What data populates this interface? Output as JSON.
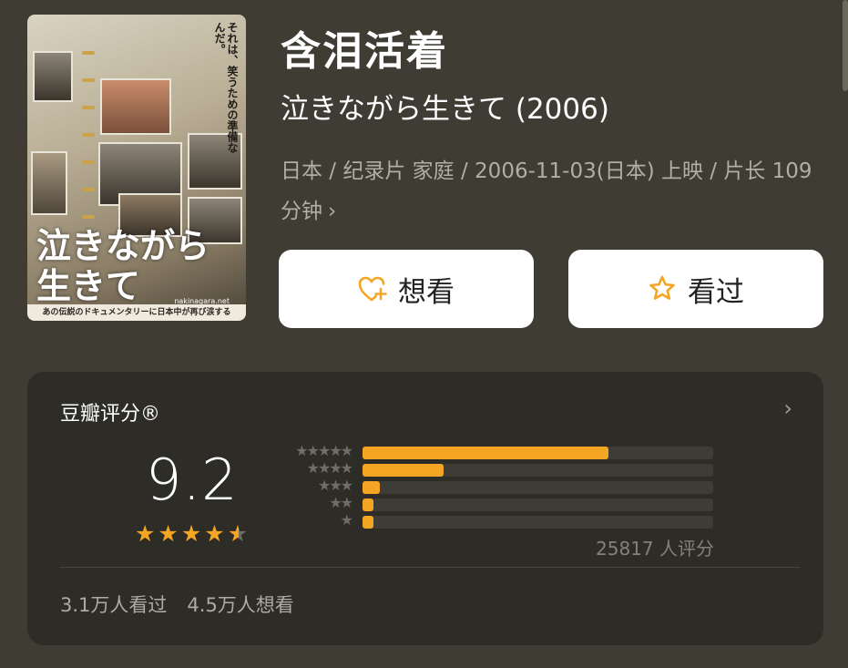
{
  "movie": {
    "title_cn": "含泪活着",
    "title_original": "泣きながら生きて (2006)",
    "meta": "日本 / 纪录片 家庭 / 2006-11-03(日本) 上映 / 片长 109分钟",
    "meta_chevron": "›"
  },
  "poster": {
    "title": "泣きながら\n生きて",
    "site": "nakinagara.net",
    "bottom_bar": "あの伝説のドキュメンタリーに日本中が再び涙する",
    "tagline": "それは、笑うための準備なんだ。"
  },
  "actions": {
    "want_label": "想看",
    "want_icon": "heart-plus-icon",
    "seen_label": "看过",
    "seen_icon": "star-outline-icon"
  },
  "rating": {
    "header": "豆瓣评分®",
    "more": "›",
    "score": "9.2",
    "stars_value": 4.6,
    "distribution": [
      {
        "stars": 5,
        "label": "★★★★★",
        "fraction": 0.7
      },
      {
        "stars": 4,
        "label": "★★★★",
        "fraction": 0.23
      },
      {
        "stars": 3,
        "label": "★★★",
        "fraction": 0.05
      },
      {
        "stars": 2,
        "label": "★★",
        "fraction": 0.03
      },
      {
        "stars": 1,
        "label": "★",
        "fraction": 0.03
      }
    ],
    "count_text": "25817 人评分",
    "watched_text": "3.1万人看过",
    "want_text": "4.5万人想看"
  },
  "colors": {
    "accent": "#f5a524",
    "background": "#3e3c33",
    "card": "#2e2c26"
  }
}
